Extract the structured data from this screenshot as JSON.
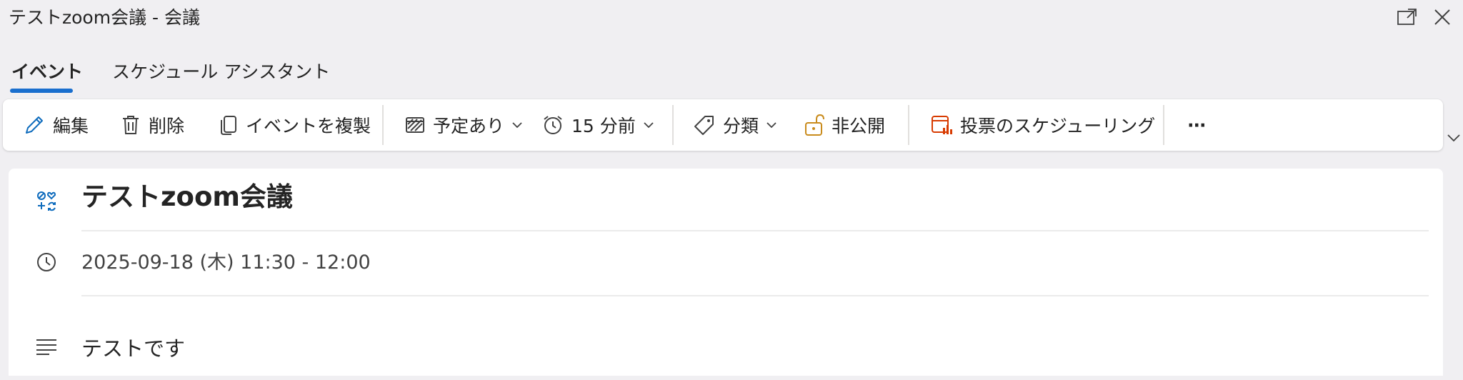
{
  "window": {
    "title": "テストzoom会議 - 会議",
    "popout_icon": "popout-icon",
    "close_icon": "close-icon"
  },
  "tabs": [
    {
      "label": "イベント",
      "active": true
    },
    {
      "label": "スケジュール アシスタント",
      "active": false
    }
  ],
  "toolbar": {
    "edit": {
      "label": "編集",
      "icon": "pencil-icon"
    },
    "delete": {
      "label": "削除",
      "icon": "trash-icon"
    },
    "duplicate": {
      "label": "イベントを複製",
      "icon": "copy-icon"
    },
    "show_as": {
      "label": "予定あり",
      "icon": "busy-status-icon"
    },
    "reminder": {
      "label": "15 分前",
      "icon": "alarm-clock-icon"
    },
    "categorize": {
      "label": "分類",
      "icon": "tag-icon"
    },
    "private": {
      "label": "非公開",
      "icon": "unlocked-icon"
    },
    "poll": {
      "label": "投票のスケジューリング",
      "icon": "scheduling-poll-icon"
    },
    "more": {
      "label": "···",
      "icon": "more-icon"
    }
  },
  "event": {
    "title": "テストzoom会議",
    "datetime": "2025-09-18 (木) 11:30 - 12:00",
    "description": "テストです"
  },
  "colors": {
    "accent": "#1a6fce",
    "icon_blue": "#0f6cbd",
    "private_icon": "#c98b1c",
    "poll_icon": "#d83b01",
    "background": "#f0eff2"
  }
}
